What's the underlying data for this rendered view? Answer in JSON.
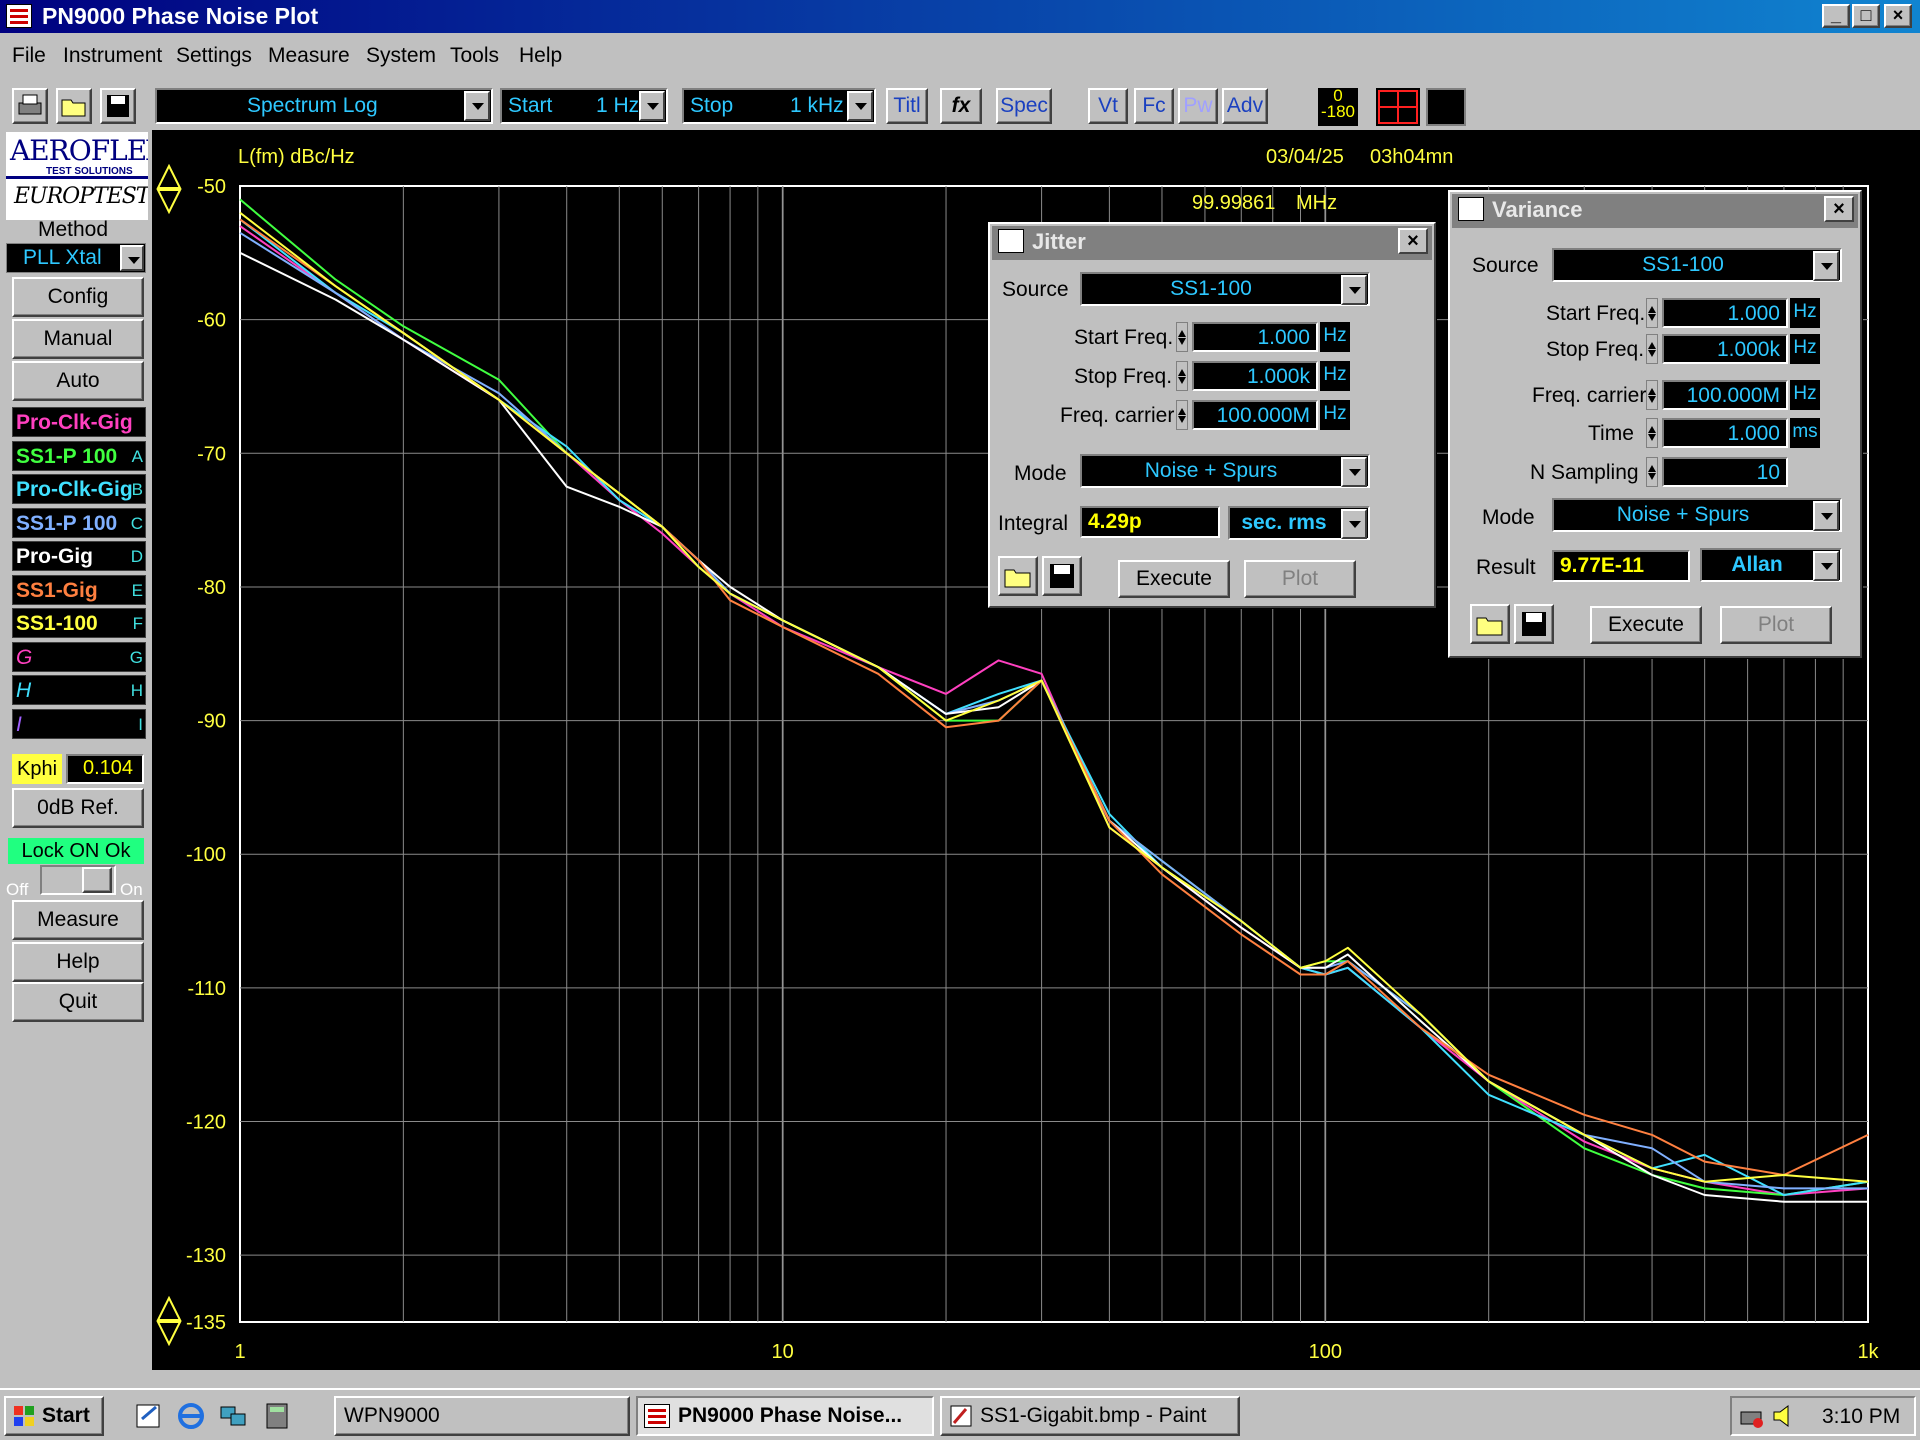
{
  "window": {
    "title": "PN9000 Phase Noise Plot",
    "min_label": "_",
    "max_label": "□",
    "close_label": "×"
  },
  "menu": [
    "File",
    "Instrument",
    "Settings",
    "Measure",
    "System",
    "Tools",
    "Help"
  ],
  "toolbar": {
    "mode_value": "Spectrum Log",
    "start_label": "Start",
    "start_value": "1 Hz",
    "stop_label": "Stop",
    "stop_value": "1 kHz",
    "buttons": [
      "Titl",
      "fx",
      "Spec",
      "Vt",
      "Fc",
      "Pw",
      "Adv"
    ],
    "phase_top": "0",
    "phase_bottom": "-180"
  },
  "sidebar": {
    "logo_line1": "AEROFLEX",
    "logo_sub": "TEST SOLUTIONS",
    "logo_line2": "EUROPTEST",
    "method_label": "Method",
    "method_value": "PLL Xtal",
    "config": "Config",
    "manual": "Manual",
    "auto": "Auto",
    "traces": [
      {
        "name": "Pro-Clk-Gig",
        "letter": "",
        "color": "#ff40c0"
      },
      {
        "name": "SS1-P 100",
        "letter": "A",
        "color": "#40ff40"
      },
      {
        "name": "Pro-Clk-Gig",
        "letter": "B",
        "color": "#40e0ff"
      },
      {
        "name": "SS1-P 100",
        "letter": "C",
        "color": "#80b0ff"
      },
      {
        "name": "Pro-Gig",
        "letter": "D",
        "color": "#ffffff"
      },
      {
        "name": "SS1-Gig",
        "letter": "E",
        "color": "#ff8040"
      },
      {
        "name": "SS1-100",
        "letter": "F",
        "color": "#ffff40"
      },
      {
        "name": "G",
        "letter": "G",
        "color": "#ff40c0"
      },
      {
        "name": "H",
        "letter": "H",
        "color": "#40e0ff"
      },
      {
        "name": "I",
        "letter": "I",
        "color": "#a060ff"
      }
    ],
    "kphi_label": "Kphi",
    "kphi_value": "0.104",
    "odb_ref": "0dB Ref.",
    "lock_status": "Lock ON Ok",
    "off_label": "Off",
    "on_label": "On",
    "measure": "Measure",
    "help": "Help",
    "quit": "Quit"
  },
  "plot": {
    "ylabel": "L(fm) dBc/Hz",
    "date": "03/04/25",
    "time": "03h04mn",
    "carrier": "99.99861",
    "carrier_unit": "MHz"
  },
  "chart_data": {
    "type": "line",
    "title": "",
    "xlabel": "",
    "ylabel": "L(fm) dBc/Hz",
    "x_scale": "log",
    "xlim": [
      1,
      1000
    ],
    "ylim": [
      -135,
      -50
    ],
    "x_ticks": [
      "1",
      "10",
      "100",
      "1k"
    ],
    "y_ticks": [
      "-50",
      "-60",
      "-70",
      "-80",
      "-90",
      "-100",
      "-110",
      "-120",
      "-130",
      "-135"
    ],
    "grid": true,
    "x": [
      1,
      1.5,
      2,
      3,
      4,
      5,
      6,
      7,
      8,
      10,
      15,
      20,
      25,
      30,
      40,
      50,
      70,
      90,
      100,
      110,
      150,
      200,
      300,
      400,
      500,
      700,
      1000
    ],
    "series": [
      {
        "name": "Pro-Clk-Gig",
        "color": "#ff40c0",
        "values": [
          -53,
          -58,
          -61.5,
          -66,
          -70,
          -73.5,
          -76,
          -78.5,
          -80.5,
          -83,
          -86,
          -88,
          -85.5,
          -86.5,
          -98,
          -101,
          -105.5,
          -108.5,
          -109,
          -108.5,
          -113,
          -117,
          -121.5,
          -123.5,
          -124.5,
          -125.5,
          -125
        ]
      },
      {
        "name": "SS1-P 100",
        "color": "#40ff40",
        "values": [
          -51,
          -57,
          -60.5,
          -64.5,
          -70,
          -73,
          -75.5,
          -78.5,
          -80.5,
          -82.5,
          -86,
          -90,
          -90,
          -87,
          -97.5,
          -100.5,
          -105,
          -108.5,
          -108,
          -108,
          -112,
          -117,
          -122,
          -124,
          -125,
          -125.5,
          -124.5
        ]
      },
      {
        "name": "Pro-Clk-Gig",
        "color": "#40e0ff",
        "values": [
          -52.5,
          -58,
          -61,
          -66,
          -69.5,
          -73.5,
          -75.5,
          -78,
          -80.5,
          -82.5,
          -86,
          -89.5,
          -88,
          -87,
          -97,
          -101,
          -105,
          -108.5,
          -109,
          -108.5,
          -113,
          -118,
          -121,
          -123.5,
          -122.5,
          -125.5,
          -124.5
        ]
      },
      {
        "name": "SS1-P 100",
        "color": "#80b0ff",
        "values": [
          -53.5,
          -58,
          -61.5,
          -65.5,
          -70,
          -73,
          -75.5,
          -78,
          -80.5,
          -82.5,
          -86,
          -89.5,
          -88.5,
          -87,
          -97.5,
          -100.5,
          -105,
          -108.5,
          -108.5,
          -108,
          -112,
          -117,
          -121,
          -122,
          -124.5,
          -125,
          -125
        ]
      },
      {
        "name": "Pro-Gig",
        "color": "#ffffff",
        "values": [
          -55,
          -58.5,
          -61.5,
          -66,
          -72.5,
          -74,
          -75.5,
          -78,
          -80,
          -82.5,
          -86,
          -89.5,
          -89,
          -87,
          -97.5,
          -101,
          -105.5,
          -108.5,
          -108.5,
          -107.5,
          -112.5,
          -117,
          -121,
          -124,
          -125.5,
          -126,
          -126
        ]
      },
      {
        "name": "SS1-Gig",
        "color": "#ff8040",
        "values": [
          -52.5,
          -57.5,
          -61,
          -66,
          -70,
          -73,
          -75.5,
          -78,
          -81,
          -83,
          -86.5,
          -90.5,
          -90,
          -87,
          -97.5,
          -101.5,
          -106,
          -109,
          -109,
          -108,
          -113,
          -116.5,
          -119.5,
          -121,
          -123,
          -124,
          -121
        ]
      },
      {
        "name": "SS1-100",
        "color": "#ffff40",
        "values": [
          -52,
          -57.5,
          -61,
          -66,
          -70,
          -73,
          -75.5,
          -78.5,
          -80.5,
          -82.5,
          -86,
          -90,
          -88.5,
          -87,
          -98,
          -101,
          -105,
          -108.5,
          -108,
          -107,
          -112,
          -117,
          -121,
          -123.5,
          -124.5,
          -124,
          -124.5
        ]
      }
    ]
  },
  "jitter": {
    "title": "Jitter",
    "source_label": "Source",
    "source_value": "SS1-100",
    "start_label": "Start Freq.",
    "start_value": "1.000",
    "start_unit": "Hz",
    "stop_label": "Stop Freq.",
    "stop_value": "1.000k",
    "stop_unit": "Hz",
    "carrier_label": "Freq. carrier",
    "carrier_value": "100.000M",
    "carrier_unit": "Hz",
    "mode_label": "Mode",
    "mode_value": "Noise + Spurs",
    "integral_label": "Integral",
    "integral_value": "4.29p",
    "integral_unit": "sec. rms",
    "execute": "Execute",
    "plot": "Plot"
  },
  "variance": {
    "title": "Variance",
    "source_label": "Source",
    "source_value": "SS1-100",
    "start_label": "Start Freq.",
    "start_value": "1.000",
    "start_unit": "Hz",
    "stop_label": "Stop Freq.",
    "stop_value": "1.000k",
    "stop_unit": "Hz",
    "carrier_label": "Freq. carrier",
    "carrier_value": "100.000M",
    "carrier_unit": "Hz",
    "time_label": "Time",
    "time_value": "1.000",
    "time_unit": "ms",
    "nsamp_label": "N Sampling",
    "nsamp_value": "10",
    "mode_label": "Mode",
    "mode_value": "Noise + Spurs",
    "result_label": "Result",
    "result_value": "9.77E-11",
    "result_type": "Allan",
    "execute": "Execute",
    "plot": "Plot"
  },
  "taskbar": {
    "start": "Start",
    "tasks": [
      "WPN9000",
      "PN9000 Phase Noise...",
      "SS1-Gigabit.bmp - Paint"
    ],
    "clock": "3:10 PM"
  }
}
